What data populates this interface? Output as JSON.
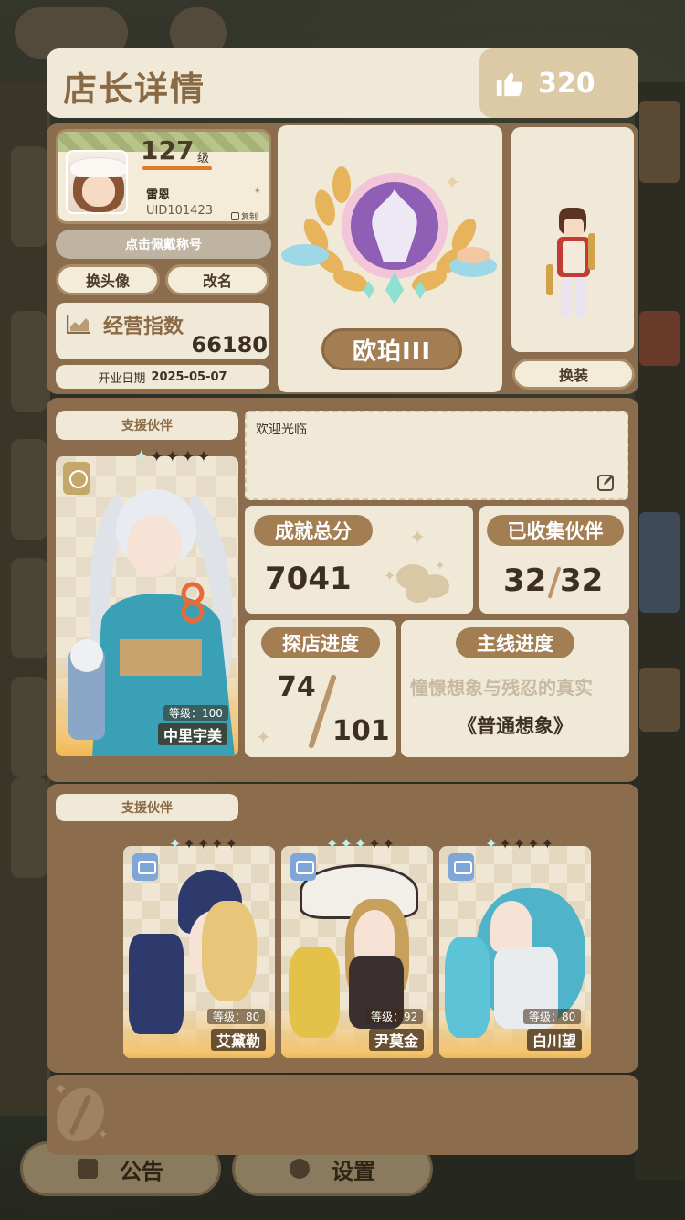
{
  "background": {
    "bottom_buttons": [
      {
        "label": "公告",
        "icon": "briefcase-icon"
      },
      {
        "label": "设置",
        "icon": "gear-icon"
      }
    ]
  },
  "header": {
    "title": "店长详情",
    "likes": "320",
    "likes_icon": "thumbs-up-icon"
  },
  "profile": {
    "level": "127",
    "level_unit": "级",
    "name": "雷恩",
    "uid": "UID101423",
    "copy_label": "复制",
    "wear_title_button": "点击佩戴称号",
    "change_avatar_button": "换头像",
    "rename_button": "改名",
    "business_index_label": "经营指数",
    "business_index_value": "66180",
    "open_date_label": "开业日期",
    "open_date_value": "2025-05-07"
  },
  "badge": {
    "rank": "欧珀III"
  },
  "outfit": {
    "change_outfit_button": "换装"
  },
  "main_partner": {
    "section_label": "支援伙伴",
    "level_text": "等级：100",
    "name": "中里宇美",
    "stars_lit": 1,
    "stars_total": 5
  },
  "message": {
    "text": "欢迎光临"
  },
  "stats": {
    "achievement_label": "成就总分",
    "achievement_value": "7041",
    "collected_label": "已收集伙伴",
    "collected_value": "32",
    "collected_total": "32",
    "explore_label": "探店进度",
    "explore_value": "74",
    "explore_total": "101",
    "story_label": "主线进度",
    "story_chapter": "憧憬想象与残忍的真实",
    "story_mode": "《普通想象》"
  },
  "support_partners": {
    "section_label": "支援伙伴",
    "items": [
      {
        "level_text": "等级：80",
        "name": "艾黛勒",
        "color": "#2d3a6b",
        "hair": "#e8c679"
      },
      {
        "level_text": "等级：92",
        "name": "尹莫金",
        "color": "#3a3030",
        "hair": "#c7a15b"
      },
      {
        "level_text": "等级：80",
        "name": "白川望",
        "color": "#d9e3ea",
        "hair": "#4fb3c9"
      }
    ]
  },
  "colors": {
    "panel_bg": "#f1e9d8",
    "section_bg": "#8b6d4e",
    "accent_brown": "#a37e53",
    "title_brown": "#8a6a45",
    "likes_bg": "#dcc9a6"
  }
}
